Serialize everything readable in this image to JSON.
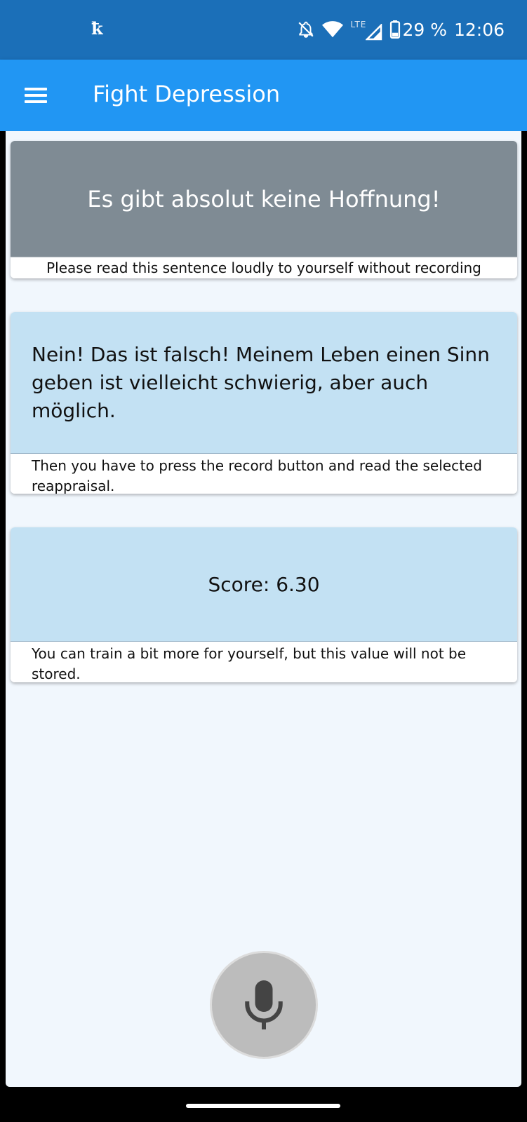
{
  "status_bar": {
    "app_badge": "ꝁ",
    "lte_label": "LTE",
    "battery": "29 %",
    "time": "12:06",
    "icons": [
      "notifications-off-icon",
      "wifi-icon",
      "signal-icon",
      "battery-icon"
    ]
  },
  "app_bar": {
    "title": "Fight Depression",
    "menu_icon": "hamburger-menu-icon",
    "color": "#2196f3"
  },
  "cards": {
    "negative_thought": {
      "text": "Es gibt absolut keine Hoffnung!",
      "instruction": "Please read this sentence loudly to yourself without recording",
      "color": "#7f8b94"
    },
    "reappraisal": {
      "text": "Nein! Das ist falsch! Meinem Leben einen Sinn geben ist vielleicht schwierig, aber auch möglich.",
      "instruction": "Then you have to press the record button and read the selected reappraisal.",
      "color": "#c3e1f3"
    },
    "score": {
      "text": "Score: 6.30",
      "instruction": "You can train a bit more for yourself, but this value will not be stored.",
      "color": "#c3e1f3"
    }
  },
  "record_button": {
    "icon": "microphone-icon"
  }
}
